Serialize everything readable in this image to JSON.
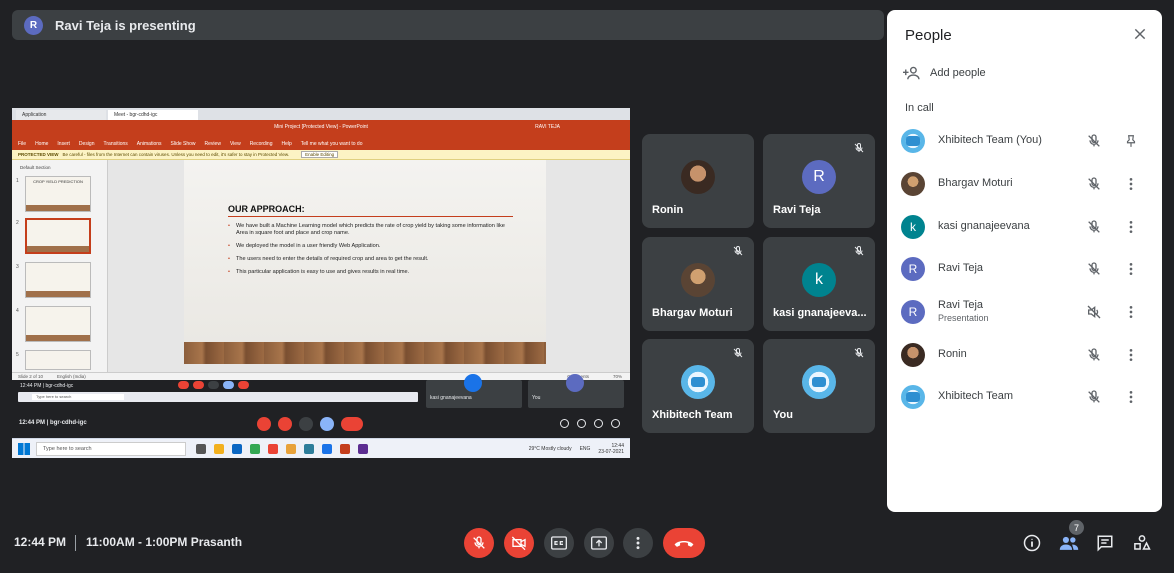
{
  "banner": {
    "avatar_letter": "R",
    "text": "Ravi Teja is presenting"
  },
  "shared_screen": {
    "browser_tabs": [
      "Application",
      "Meet - bgr-cdhd-igc"
    ],
    "app_title": "Mini Project [Protected View] - PowerPoint",
    "app_user": "RAVI TEJA",
    "ribbon_menu": [
      "File",
      "Home",
      "Insert",
      "Design",
      "Transitions",
      "Animations",
      "Slide Show",
      "Review",
      "View",
      "Recording",
      "Help",
      "Tell me what you want to do"
    ],
    "protected_label": "PROTECTED VIEW",
    "protected_text": "Be careful - files from the Internet can contain viruses. Unless you need to edit, it's safer to stay in Protected View.",
    "enable_editing": "Enable Editing",
    "section": "Default Section",
    "thumb1_text": "CROP YIELD PREDICTION",
    "slide_numbers": [
      "1",
      "2",
      "3",
      "4",
      "5"
    ],
    "slide_heading": "OUR APPROACH:",
    "bullets": [
      "We have built a Machine Learning model which predicts the rate of crop yield by taking some information like Area in square foot and place and crop name.",
      "We deployed the model in a user friendly Web Application.",
      "The users need to enter the details of  required crop and area to get the result.",
      "This particular application is easy to use and gives results in real time."
    ],
    "status_slide": "Slide 2 of 10",
    "status_lang": "English (India)",
    "status_comments": "Comments",
    "status_zoom": "70%",
    "nested_clock": "12:44 PM | bgr-cdhd-igc",
    "nested_tiles": [
      "kasi gnanajeevana",
      "You"
    ],
    "nested_search": "Type here to search",
    "meet_clock": "12:44 PM  |  bgr-cdhd-igc",
    "taskbar_search": "Type here to search",
    "weather": "29°C  Mostly cloudy",
    "lang": "ENG",
    "time": "12:44",
    "date": "23-07-2021"
  },
  "tiles": [
    {
      "name": "Ronin",
      "avatar": "photo",
      "muted": false
    },
    {
      "name": "Ravi Teja",
      "avatar": "R",
      "color": "#5c6bc0",
      "muted": true
    },
    {
      "name": "Bhargav Moturi",
      "avatar": "photo",
      "muted": true
    },
    {
      "name": "kasi gnanajeeva...",
      "avatar": "k",
      "color": "#00838f",
      "muted": true
    },
    {
      "name": "Xhibitech Team",
      "avatar": "logo",
      "muted": true
    },
    {
      "name": "You",
      "avatar": "logo",
      "muted": true
    }
  ],
  "people_panel": {
    "title": "People",
    "add_people": "Add people",
    "in_call": "In call",
    "participants": [
      {
        "name": "Xhibitech Team (You)",
        "avatar": "logo",
        "action": "pin-icon"
      },
      {
        "name": "Bhargav Moturi",
        "avatar": "photo",
        "action": "more-vert-icon"
      },
      {
        "name": "kasi gnanajeevana",
        "avatar": "k",
        "color": "#00838f",
        "action": "more-vert-icon"
      },
      {
        "name": "Ravi Teja",
        "avatar": "R",
        "color": "#5c6bc0",
        "action": "more-vert-icon"
      },
      {
        "name": "Ravi Teja",
        "sub": "Presentation",
        "avatar": "R",
        "color": "#5c6bc0",
        "action": "more-vert-icon",
        "audio": "volume-off-icon"
      },
      {
        "name": "Ronin",
        "avatar": "photo",
        "action": "more-vert-icon"
      },
      {
        "name": "Xhibitech Team",
        "avatar": "logo",
        "action": "more-vert-icon"
      }
    ]
  },
  "bottom_bar": {
    "time": "12:44 PM",
    "meeting": "11:00AM - 1:00PM Prasanth",
    "people_count": "7"
  },
  "colors": {
    "background": "#202124",
    "tile": "#3c4043",
    "danger": "#ea4335",
    "panel": "#ffffff"
  }
}
